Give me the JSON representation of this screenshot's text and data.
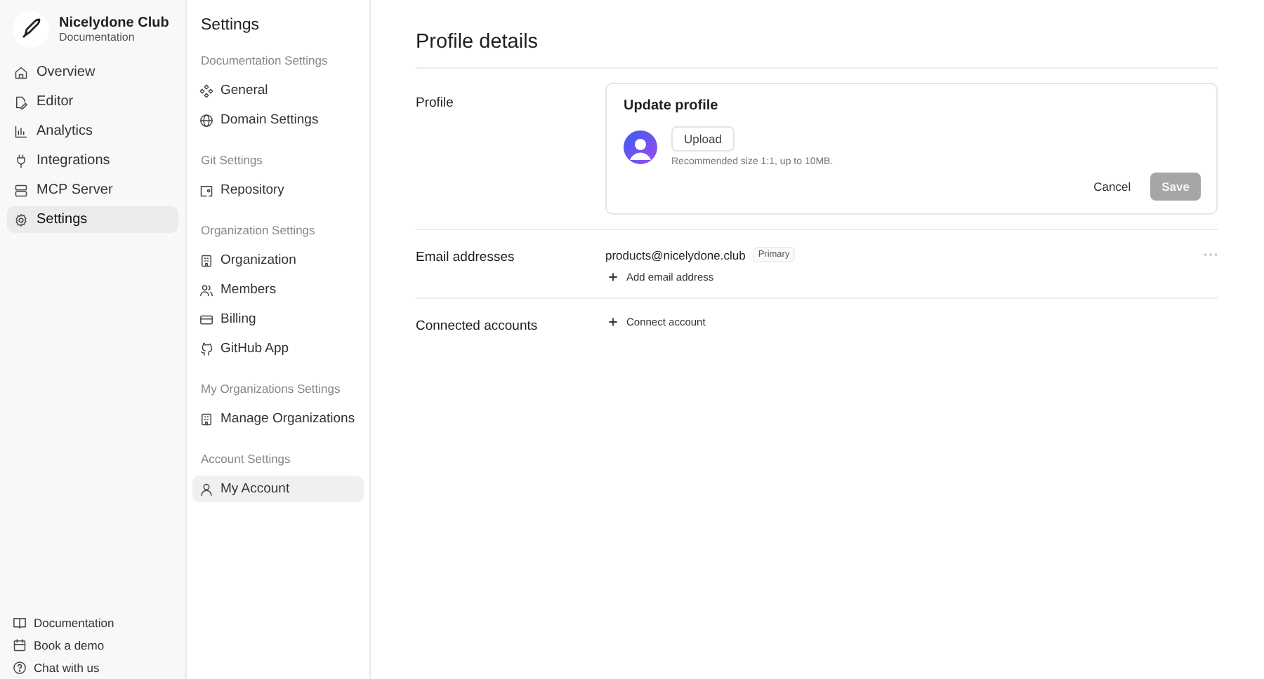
{
  "workspace": {
    "name": "Nicelydone Club",
    "subtitle": "Documentation"
  },
  "nav": [
    {
      "label": "Overview",
      "kind": "home",
      "selected": false
    },
    {
      "label": "Editor",
      "kind": "edit",
      "selected": false
    },
    {
      "label": "Analytics",
      "kind": "chart",
      "selected": false
    },
    {
      "label": "Integrations",
      "kind": "plug",
      "selected": false
    },
    {
      "label": "MCP Server",
      "kind": "server",
      "selected": false
    },
    {
      "label": "Settings",
      "kind": "gear",
      "selected": true
    }
  ],
  "footer_links": [
    {
      "label": "Documentation",
      "kind": "book"
    },
    {
      "label": "Book a demo",
      "kind": "calendar"
    },
    {
      "label": "Chat with us",
      "kind": "help"
    }
  ],
  "settings_menu": {
    "title": "Settings",
    "groups": [
      {
        "heading": "Documentation Settings",
        "items": [
          {
            "label": "General",
            "kind": "diamond",
            "selected": false
          },
          {
            "label": "Domain Settings",
            "kind": "globe",
            "selected": false
          }
        ]
      },
      {
        "heading": "Git Settings",
        "items": [
          {
            "label": "Repository",
            "kind": "repo",
            "selected": false
          }
        ]
      },
      {
        "heading": "Organization Settings",
        "items": [
          {
            "label": "Organization",
            "kind": "building",
            "selected": false
          },
          {
            "label": "Members",
            "kind": "users",
            "selected": false
          },
          {
            "label": "Billing",
            "kind": "card",
            "selected": false
          },
          {
            "label": "GitHub App",
            "kind": "github",
            "selected": false
          }
        ]
      },
      {
        "heading": "My Organizations Settings",
        "items": [
          {
            "label": "Manage Organizations",
            "kind": "building",
            "selected": false
          }
        ]
      },
      {
        "heading": "Account Settings",
        "items": [
          {
            "label": "My Account",
            "kind": "user",
            "selected": true
          }
        ]
      }
    ]
  },
  "page": {
    "title": "Profile details",
    "profile": {
      "label": "Profile",
      "card_title": "Update profile",
      "upload_button": "Upload",
      "hint": "Recommended size 1:1, up to 10MB.",
      "cancel_button": "Cancel",
      "save_button": {
        "label": "Save",
        "disabled": true
      }
    },
    "email": {
      "label": "Email addresses",
      "address": "products@nicelydone.club",
      "badge": "Primary",
      "add_label": "Add email address"
    },
    "connected": {
      "label": "Connected accounts",
      "add_label": "Connect account"
    }
  }
}
